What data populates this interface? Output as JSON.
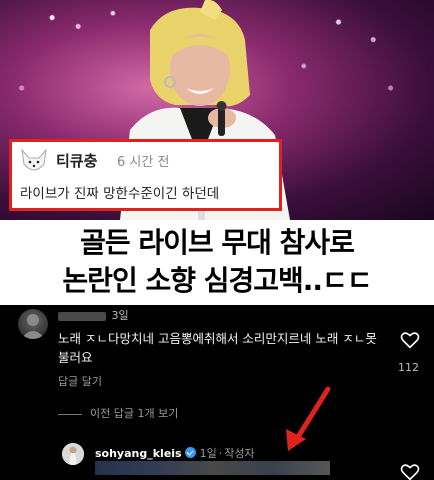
{
  "card": {
    "username": "티큐충",
    "time": "6 시간 전",
    "text": "라이브가 진짜 망한수준이긴 하던데"
  },
  "headline": {
    "line1": "골든 라이브 무대 참사로",
    "line2": "논란인 소향 심경고백..ㄷㄷ"
  },
  "thread": {
    "comment": {
      "time": "3일",
      "text": "노래 ㅈㄴ다망치네 고음뽕에취해서 소리만지르네 노래 ㅈㄴ못불러요",
      "reply_label": "답글 달기",
      "likes": "112"
    },
    "view_replies": "이전 답글 1개 보기",
    "reply": {
      "username": "sohyang_kleis",
      "time": "1일",
      "tag": "작성자"
    }
  },
  "colors": {
    "card_border": "#e0221c",
    "verified": "#3897f0",
    "arrow": "#e0221c"
  }
}
